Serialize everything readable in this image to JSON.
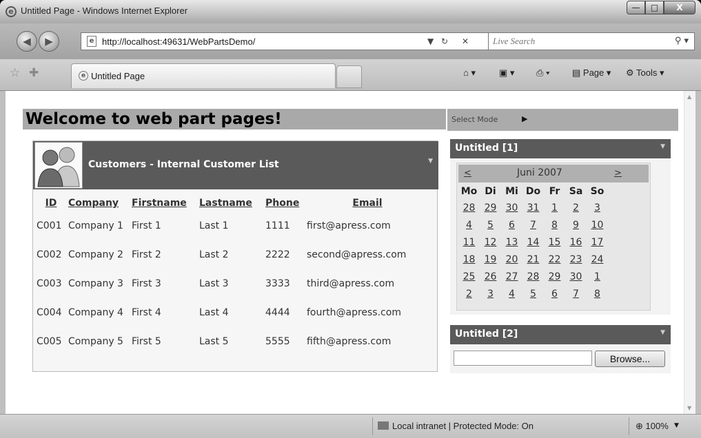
{
  "window": {
    "title": "Untitled Page - Windows Internet Explorer",
    "minimize_glyph": "—",
    "maximize_glyph": "□",
    "close_glyph": "X"
  },
  "address": {
    "url": "http://localhost:49631/WebPartsDemo/",
    "search_placeholder": "Live Search"
  },
  "tabs": [
    {
      "label": "Untitled Page"
    }
  ],
  "command_bar": {
    "page_label": "Page",
    "tools_label": "Tools"
  },
  "page": {
    "heading": "Welcome to web part pages!",
    "select_mode_label": "Select Mode"
  },
  "customers_part": {
    "title": "Customers - Internal Customer List",
    "columns": [
      "ID",
      "Company",
      "Firstname",
      "Lastname",
      "Phone",
      "Email"
    ],
    "rows": [
      {
        "id": "C001",
        "company": "Company 1",
        "firstname": "First 1",
        "lastname": "Last 1",
        "phone": "1111",
        "email": "first@apress.com"
      },
      {
        "id": "C002",
        "company": "Company 2",
        "firstname": "First 2",
        "lastname": "Last 2",
        "phone": "2222",
        "email": "second@apress.com"
      },
      {
        "id": "C003",
        "company": "Company 3",
        "firstname": "First 3",
        "lastname": "Last 3",
        "phone": "3333",
        "email": "third@apress.com"
      },
      {
        "id": "C004",
        "company": "Company 4",
        "firstname": "First 4",
        "lastname": "Last 4",
        "phone": "4444",
        "email": "fourth@apress.com"
      },
      {
        "id": "C005",
        "company": "Company 5",
        "firstname": "First 5",
        "lastname": "Last 5",
        "phone": "5555",
        "email": "fifth@apress.com"
      }
    ]
  },
  "calendar_part": {
    "title": "Untitled [1]",
    "prev_label": "<",
    "next_label": ">",
    "month_label": "Juni 2007",
    "day_headers": [
      "Mo",
      "Di",
      "Mi",
      "Do",
      "Fr",
      "Sa",
      "So"
    ],
    "weeks": [
      [
        "28",
        "29",
        "30",
        "31",
        "1",
        "2",
        "3"
      ],
      [
        "4",
        "5",
        "6",
        "7",
        "8",
        "9",
        "10"
      ],
      [
        "11",
        "12",
        "13",
        "14",
        "15",
        "16",
        "17"
      ],
      [
        "18",
        "19",
        "20",
        "21",
        "22",
        "23",
        "24"
      ],
      [
        "25",
        "26",
        "27",
        "28",
        "29",
        "30",
        "1"
      ],
      [
        "2",
        "3",
        "4",
        "5",
        "6",
        "7",
        "8"
      ]
    ]
  },
  "upload_part": {
    "title": "Untitled [2]",
    "browse_label": "Browse..."
  },
  "status": {
    "zone_text": "Local intranet | Protected Mode: On",
    "zoom": "100%"
  }
}
